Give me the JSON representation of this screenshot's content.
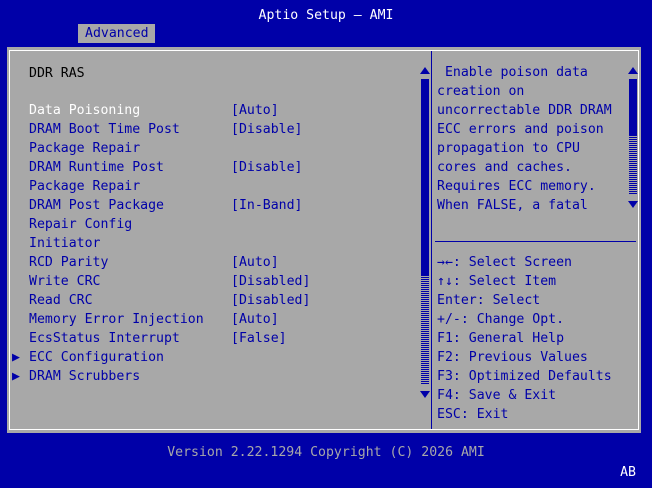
{
  "header": {
    "title": "Aptio Setup – AMI"
  },
  "tabs": [
    {
      "label": "Advanced",
      "active": true
    }
  ],
  "page": {
    "heading": "DDR RAS"
  },
  "settings": [
    {
      "label": "Data Poisoning",
      "value": "[Auto]",
      "selected": true
    },
    {
      "label": "DRAM Boot Time Post",
      "value": "[Disable]"
    },
    {
      "label": "Package Repair",
      "value": ""
    },
    {
      "label": "DRAM Runtime Post",
      "value": "[Disable]"
    },
    {
      "label": "Package Repair",
      "value": ""
    },
    {
      "label": "DRAM Post Package",
      "value": "[In-Band]"
    },
    {
      "label": "Repair Config",
      "value": ""
    },
    {
      "label": "Initiator",
      "value": ""
    },
    {
      "label": "RCD Parity",
      "value": "[Auto]"
    },
    {
      "label": "Write CRC",
      "value": "[Disabled]"
    },
    {
      "label": "Read CRC",
      "value": "[Disabled]"
    },
    {
      "label": "Memory Error Injection",
      "value": "[Auto]"
    },
    {
      "label": "EcsStatus Interrupt",
      "value": "[False]"
    }
  ],
  "submenus": [
    {
      "label": "ECC Configuration"
    },
    {
      "label": "DRAM Scrubbers"
    }
  ],
  "help": {
    "lines": [
      " Enable poison data",
      "creation on",
      "uncorrectable DDR DRAM",
      "ECC errors and poison",
      "propagation to CPU",
      "cores and caches.",
      "Requires ECC memory.",
      "When FALSE, a fatal"
    ]
  },
  "keys": [
    "→←: Select Screen",
    "↑↓: Select Item",
    "Enter: Select",
    "+/-: Change Opt.",
    "F1: General Help",
    "F2: Previous Values",
    "F3: Optimized Defaults",
    "F4: Save & Exit",
    "ESC: Exit"
  ],
  "footer": {
    "version": "Version 2.22.1294 Copyright (C) 2026 AMI",
    "indicator": "AB"
  },
  "colors": {
    "background": "#0000a8",
    "panel": "#a8a8a8",
    "selected_text": "#ffffff",
    "text": "#0000a8"
  }
}
